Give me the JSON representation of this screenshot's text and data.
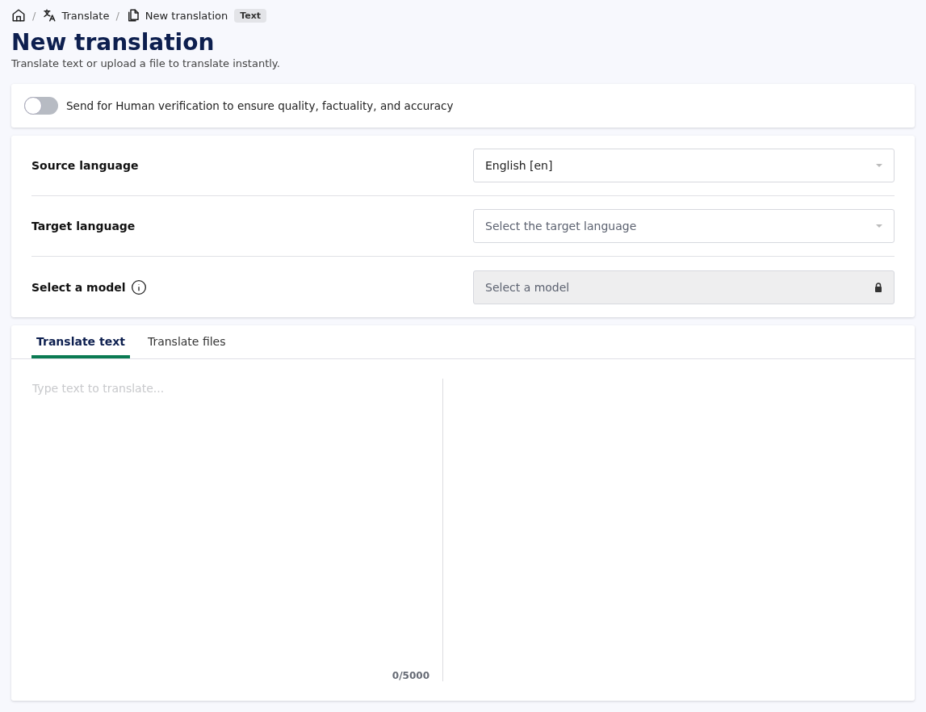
{
  "breadcrumb": [
    {
      "kind": "home"
    },
    {
      "kind": "translate",
      "separator": "/",
      "label": "Translate"
    },
    {
      "kind": "document",
      "separator": "/",
      "label": "New translation",
      "badge": "Text"
    }
  ],
  "title": "New translation",
  "subtitle": "Translate text or upload a file to translate instantly.",
  "verification": {
    "on": false,
    "label": "Send for Human verification to ensure quality, factuality, and accuracy"
  },
  "settings": [
    {
      "label": "Source language",
      "kind": "select",
      "value": "English [en]"
    },
    {
      "label": "Target language",
      "kind": "select",
      "placeholder": "Select the target language"
    },
    {
      "label": "Select a model",
      "kind": "locked",
      "info": true,
      "placeholder": "Select a model"
    }
  ],
  "tabs": [
    {
      "label": "Translate text",
      "selected": true
    },
    {
      "label": "Translate files",
      "selected": false
    }
  ],
  "editor": {
    "placeholder": "Type text to translate...",
    "counter": "0/5000"
  }
}
